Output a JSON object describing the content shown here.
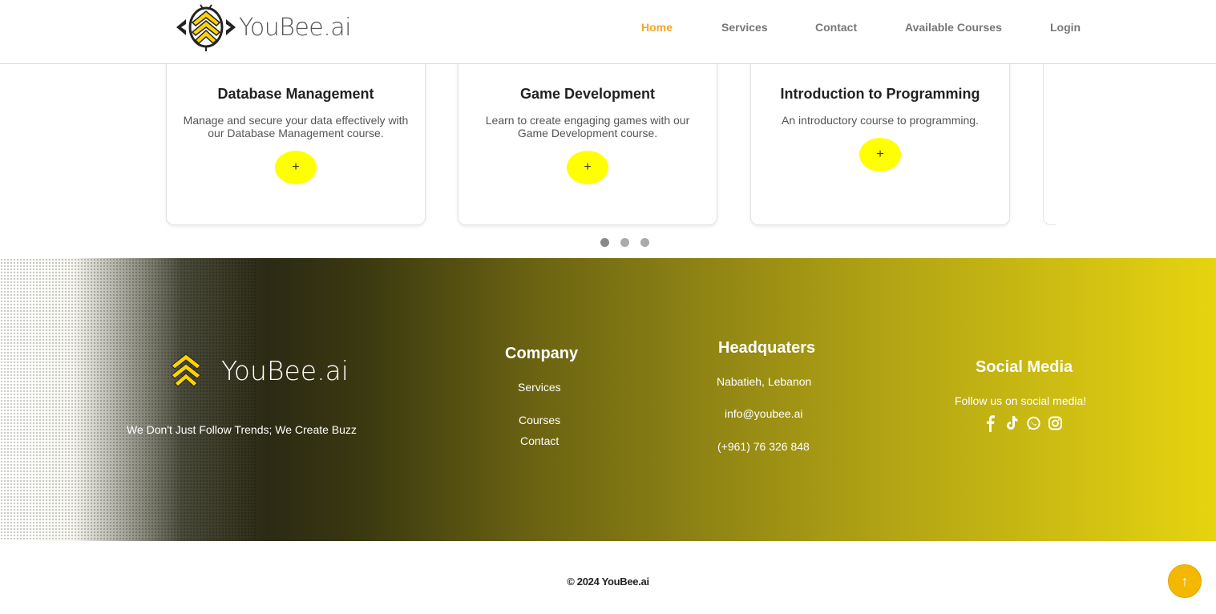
{
  "brand": {
    "name": "YouBee.ai",
    "accent": "#f5a623",
    "yellow": "#ffff00"
  },
  "nav": {
    "items": [
      {
        "label": "Home",
        "active": true
      },
      {
        "label": "Services",
        "active": false
      },
      {
        "label": "Contact",
        "active": false
      },
      {
        "label": "Available Courses",
        "active": false
      },
      {
        "label": "Login",
        "active": false
      }
    ]
  },
  "courses": [
    {
      "title": "Database Management",
      "description": "Manage and secure your data effectively with our Database Management course.",
      "button_icon": "+"
    },
    {
      "title": "Game Development",
      "description": "Learn to create engaging games with our Game Development course.",
      "button_icon": "+"
    },
    {
      "title": "Introduction to Programming",
      "description": "An introductory course to programming.",
      "button_icon": "+"
    }
  ],
  "carousel": {
    "dots": 3,
    "active_index": 0
  },
  "footer": {
    "brand_name": "YouBee.ai",
    "tagline": "We Don't Just Follow Trends; We Create Buzz",
    "company": {
      "title": "Company",
      "links": [
        "Services",
        "Courses",
        "Contact"
      ]
    },
    "headquarters": {
      "title": "Headquaters",
      "address": "Nabatieh, Lebanon",
      "email": "info@youbee.ai",
      "phone": "(+961) 76 326 848"
    },
    "social": {
      "title": "Social Media",
      "text": "Follow us on social media!",
      "icons": [
        "facebook-icon",
        "tiktok-icon",
        "whatsapp-icon",
        "instagram-icon"
      ]
    }
  },
  "copyright": "© 2024 YouBee.ai",
  "scroll_top_icon": "↑"
}
